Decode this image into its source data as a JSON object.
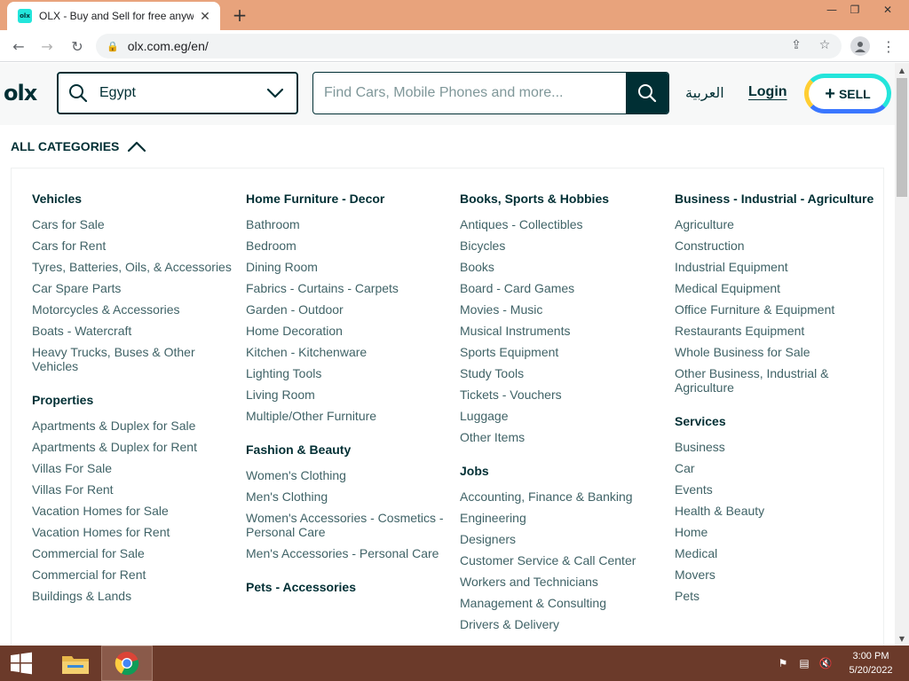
{
  "browser": {
    "tab_title": "OLX - Buy and Sell for free anyw",
    "favicon_text": "olx",
    "url": "olx.com.eg/en/",
    "tab_close_icon": "close-icon",
    "new_tab_icon": "plus-icon"
  },
  "header": {
    "logo": "olx",
    "location": "Egypt",
    "search_placeholder": "Find Cars, Mobile Phones and more...",
    "language_link": "العربية",
    "login": "Login",
    "sell": "SELL"
  },
  "all_categories": "ALL CATEGORIES",
  "columns": [
    [
      {
        "title": "Vehicles",
        "items": [
          "Cars for Sale",
          "Cars for Rent",
          "Tyres, Batteries, Oils, & Accessories",
          "Car Spare Parts",
          "Motorcycles & Accessories",
          "Boats - Watercraft",
          "Heavy Trucks, Buses & Other Vehicles"
        ]
      },
      {
        "title": "Properties",
        "items": [
          "Apartments & Duplex for Sale",
          "Apartments & Duplex for Rent",
          "Villas For Sale",
          "Villas For Rent",
          "Vacation Homes for Sale",
          "Vacation Homes for Rent",
          "Commercial for Sale",
          "Commercial for Rent",
          "Buildings & Lands"
        ]
      }
    ],
    [
      {
        "title": "Home Furniture - Decor",
        "items": [
          "Bathroom",
          "Bedroom",
          "Dining Room",
          "Fabrics - Curtains - Carpets",
          "Garden - Outdoor",
          "Home Decoration",
          "Kitchen - Kitchenware",
          "Lighting Tools",
          "Living Room",
          "Multiple/Other Furniture"
        ]
      },
      {
        "title": "Fashion & Beauty",
        "items": [
          "Women's Clothing",
          "Men's Clothing",
          "Women's Accessories - Cosmetics - Personal Care",
          "Men's Accessories - Personal Care"
        ]
      },
      {
        "title": "Pets - Accessories",
        "items": []
      }
    ],
    [
      {
        "title": "Books, Sports & Hobbies",
        "items": [
          "Antiques - Collectibles",
          "Bicycles",
          "Books",
          "Board - Card Games",
          "Movies - Music",
          "Musical Instruments",
          "Sports Equipment",
          "Study Tools",
          "Tickets - Vouchers",
          "Luggage",
          "Other Items"
        ]
      },
      {
        "title": "Jobs",
        "items": [
          "Accounting, Finance & Banking",
          "Engineering",
          "Designers",
          "Customer Service & Call Center",
          "Workers and Technicians",
          "Management & Consulting",
          "Drivers & Delivery"
        ]
      }
    ],
    [
      {
        "title": "Business - Industrial - Agriculture",
        "items": [
          "Agriculture",
          "Construction",
          "Industrial Equipment",
          "Medical Equipment",
          "Office Furniture & Equipment",
          "Restaurants Equipment",
          "Whole Business for Sale",
          "Other Business, Industrial & Agriculture"
        ]
      },
      {
        "title": "Services",
        "items": [
          "Business",
          "Car",
          "Events",
          "Health & Beauty",
          "Home",
          "Medical",
          "Movers",
          "Pets"
        ]
      }
    ]
  ],
  "taskbar": {
    "time": "3:00 PM",
    "date": "5/20/2022"
  },
  "colors": {
    "brand_dark": "#002f34",
    "brand_teal": "#23e5db",
    "brand_yellow": "#ffce32",
    "brand_blue": "#3a77ff",
    "tabbar": "#e8a37c",
    "taskbar": "#6b3a2a"
  }
}
